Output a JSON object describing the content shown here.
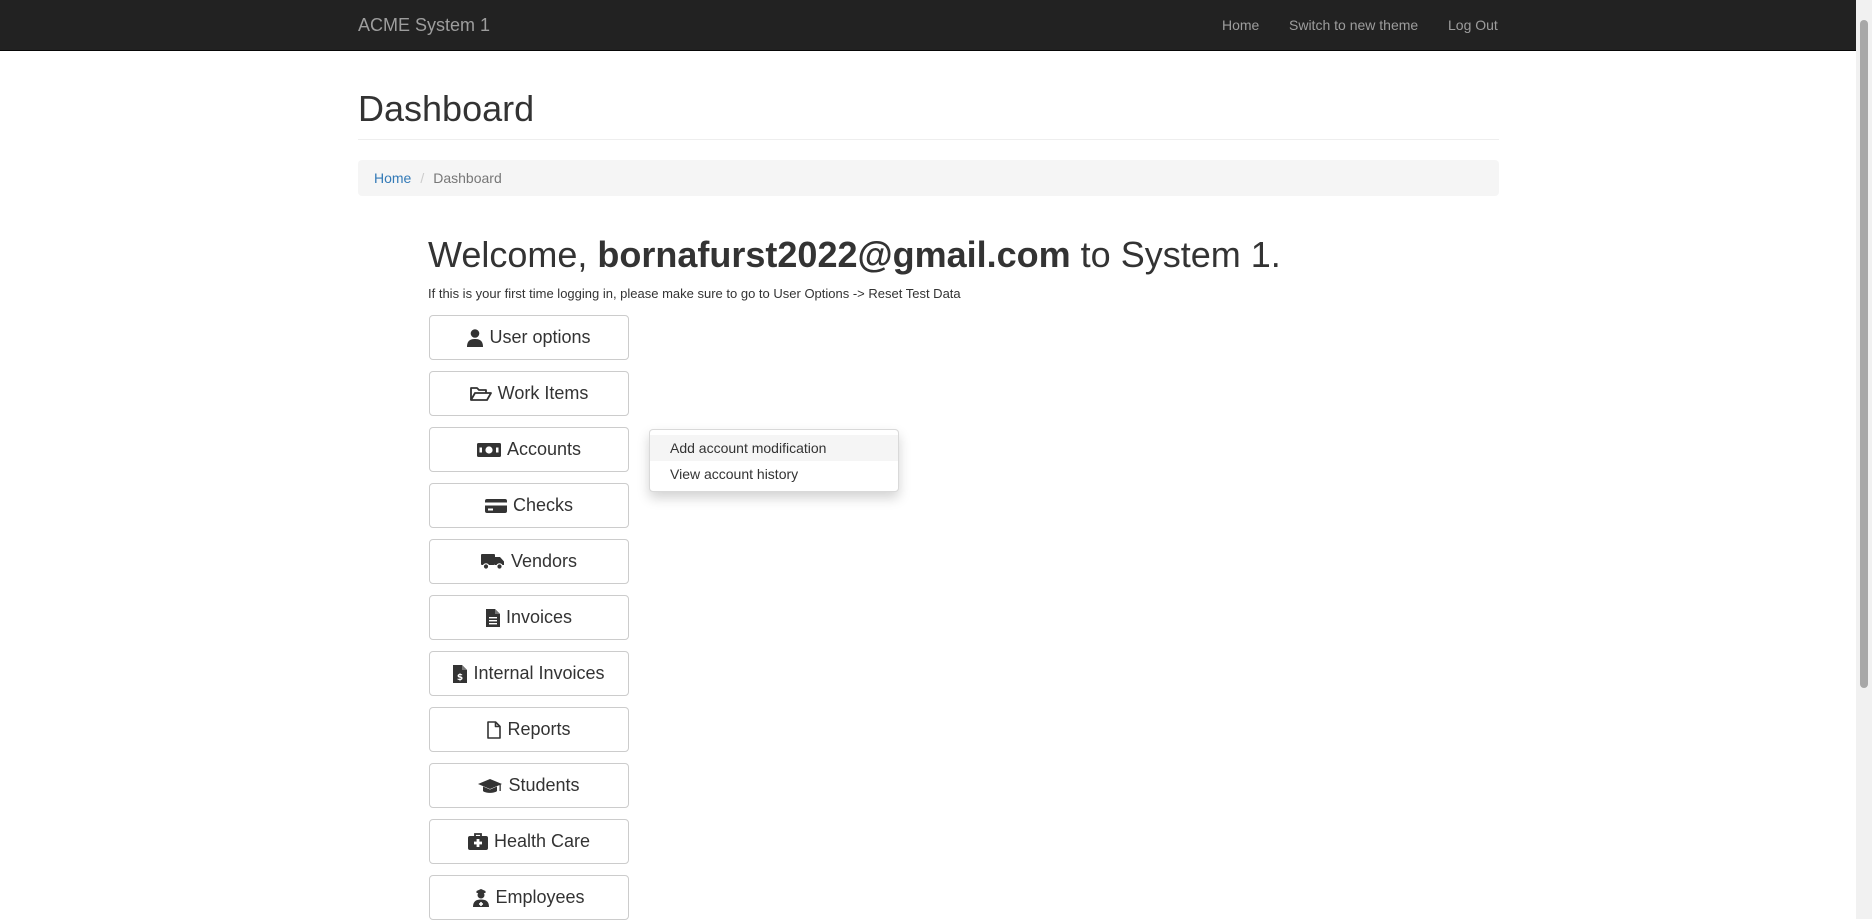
{
  "navbar": {
    "brand": "ACME System 1",
    "links": [
      "Home",
      "Switch to new theme",
      "Log Out"
    ]
  },
  "page": {
    "title": "Dashboard"
  },
  "breadcrumb": {
    "home": "Home",
    "separator": "/",
    "current": "Dashboard"
  },
  "welcome": {
    "prefix": "Welcome,",
    "user": "bornafurst2022@gmail.com",
    "suffix": "to System 1.",
    "note": "If this is your first time logging in, please make sure to go to User Options -> Reset Test Data"
  },
  "menu": [
    {
      "label": "User options",
      "icon": "user-icon"
    },
    {
      "label": "Work Items",
      "icon": "folder-open-icon"
    },
    {
      "label": "Accounts",
      "icon": "money-bill-icon"
    },
    {
      "label": "Checks",
      "icon": "credit-card-icon"
    },
    {
      "label": "Vendors",
      "icon": "truck-icon"
    },
    {
      "label": "Invoices",
      "icon": "file-lines-icon"
    },
    {
      "label": "Internal Invoices",
      "icon": "file-invoice-dollar-icon"
    },
    {
      "label": "Reports",
      "icon": "file-icon"
    },
    {
      "label": "Students",
      "icon": "graduation-cap-icon"
    },
    {
      "label": "Health Care",
      "icon": "medical-kit-icon"
    },
    {
      "label": "Employees",
      "icon": "user-nurse-icon"
    }
  ],
  "accounts_dropdown": {
    "items": [
      "Add account modification",
      "View account history"
    ]
  }
}
